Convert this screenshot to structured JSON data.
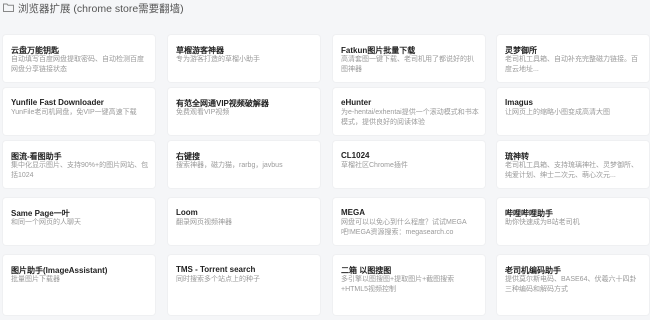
{
  "header": {
    "title": "浏览器扩展 (chrome store需要翻墙)",
    "icon": "folder-icon"
  },
  "cards": [
    {
      "name": "云盘万能钥匙",
      "desc": "自动填写百度网盘提取密码、自动检测百度网盘分享链接状态"
    },
    {
      "name": "草榴游客神器",
      "desc": "专为游客打造的草榴小助手"
    },
    {
      "name": "Fatkun图片批量下载",
      "desc": "高清套图一键下载、老司机用了都说好的扒图神器"
    },
    {
      "name": "灵梦御所",
      "desc": "老司机工具箱、自动补充完整磁力链接。百度云地址..."
    },
    {
      "name": "Yunfile Fast Downloader",
      "desc": "YunFile老司机网盘，免VIP一键高速下载"
    },
    {
      "name": "有范全网通VIP视频破解器",
      "desc": "免费观看VIP视频"
    },
    {
      "name": "eHunter",
      "desc": "为e-hentai/exhentai提供一个滚动模式和书本模式，提供良好的阅读体验"
    },
    {
      "name": "Imagus",
      "desc": "让网页上的缩略小图变成高清大图"
    },
    {
      "name": "图流-看图助手",
      "desc": "集中化显示图片、支持90%+的图片网站、包括1024"
    },
    {
      "name": "右键搜",
      "desc": "搜索神器，磁力猫，rarbg，javbus"
    },
    {
      "name": "CL1024",
      "desc": "草榴社区Chrome插件"
    },
    {
      "name": "琉神转",
      "desc": "老司机工具箱、支持琉璃神社、灵梦御所、纯爱计划、绅士二次元、萌心次元..."
    },
    {
      "name": "Same Page一叶",
      "desc": "和同一个网页的人聊天"
    },
    {
      "name": "Loom",
      "desc": "翻录网页视频神器"
    },
    {
      "name": "MEGA",
      "desc": "网盘可以以免心到什么程度？试试MEGA吧!MEGA资源搜索：megasearch.co"
    },
    {
      "name": "哔哩哔哩助手",
      "desc": "助你快速成为B站老司机"
    },
    {
      "name": "图片助手(ImageAssistant)",
      "desc": "批量图片下载器"
    },
    {
      "name": "TMS - Torrent search",
      "desc": "同时搜索多个站点上的种子"
    },
    {
      "name": "二箱 以图搜图",
      "desc": "多引擎以图搜图+提取图片+截图搜索+HTML5视频控制"
    },
    {
      "name": "老司机编码助手",
      "desc": "提供莫尔斯电码、BASE64、伏羲六十四卦 三种编码和解码方式"
    }
  ]
}
